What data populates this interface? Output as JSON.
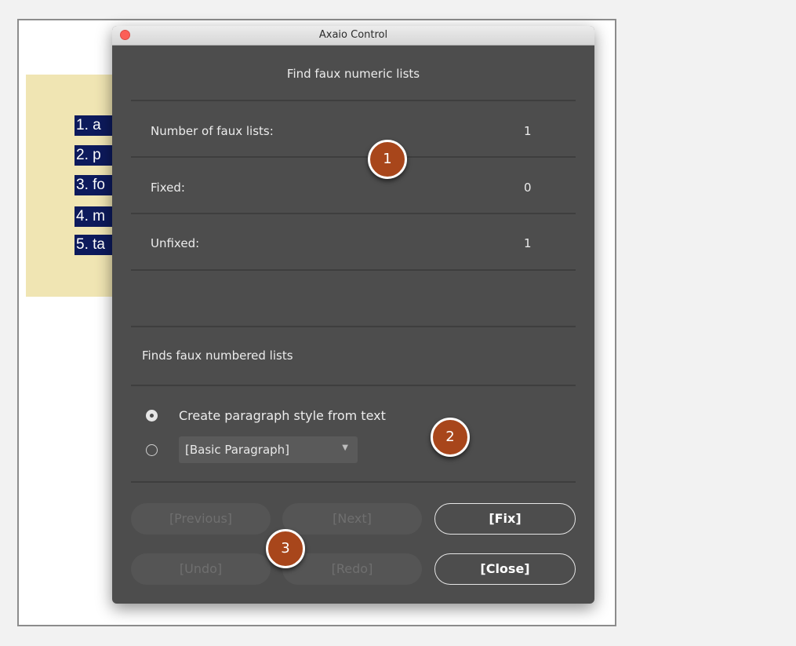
{
  "document": {
    "list_lines": [
      "1. a",
      "2. p",
      "3. fo",
      "4. m",
      "5. ta"
    ]
  },
  "dialog": {
    "title": "Axaio Control",
    "heading": "Find faux numeric lists",
    "stats": [
      {
        "label": "Number of faux lists:",
        "value": "1"
      },
      {
        "label": "Fixed:",
        "value": "0"
      },
      {
        "label": "Unfixed:",
        "value": "1"
      }
    ],
    "section_label": "Finds faux numbered lists",
    "options": {
      "create_style_label": "Create paragraph style from text",
      "create_style_selected": true,
      "paragraph_style_value": "[Basic Paragraph]"
    },
    "buttons": {
      "previous": "[Previous]",
      "next": "[Next]",
      "fix": "[Fix]",
      "undo": "[Undo]",
      "redo": "[Redo]",
      "close": "[Close]"
    }
  },
  "callouts": [
    "1",
    "2",
    "3"
  ],
  "colors": {
    "dialog_bg": "#4d4d4d",
    "callout": "#a8461b",
    "doc_highlight": "#0d1a5c",
    "doc_frame": "#f0e5b3",
    "close_dot": "#fc5f57"
  }
}
